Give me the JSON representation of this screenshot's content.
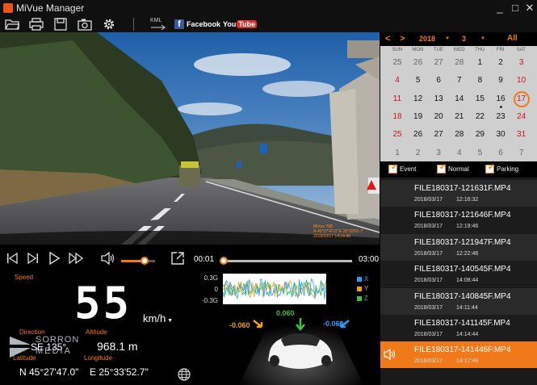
{
  "window": {
    "title": "MiVue Manager",
    "controls": {
      "minimize": "_",
      "maximize": "□",
      "close": "✕"
    }
  },
  "toolbar": {
    "icons": [
      "folder-open-icon",
      "print-icon",
      "save-icon",
      "camera-icon",
      "gear-icon",
      "kml-export-icon"
    ],
    "kml_label": "KML",
    "facebook_label": "Facebook",
    "facebook_mark": "f",
    "youtube_you": "You",
    "youtube_tube": "Tube"
  },
  "video": {
    "overlay_lines": [
      "MiVue 798",
      "N 45°27'47.0\" E 25°33'52.7\"",
      "2018/03/17 14:14:46"
    ]
  },
  "player": {
    "time_current": "00:01",
    "time_total": "03:00",
    "progress": 0.005,
    "volume": 0.7
  },
  "telemetry": {
    "speed_label": "Speed",
    "speed_value": "55",
    "speed_unit": "km/h",
    "direction_label": "Direction",
    "direction_value": "SE 135°",
    "altitude_label": "Altitude",
    "altitude_value": "968.1  m",
    "latitude_label": "Latitude",
    "latitude_value": "N 45°27'47.0\"",
    "longitude_label": "Longitude",
    "longitude_value": "E 25°33'52.7\""
  },
  "watermark": {
    "top": "SORRON",
    "bottom": "MEDIA"
  },
  "gsensor": {
    "axis_labels": [
      "0.3G",
      "0",
      "-0.3G"
    ],
    "legend": [
      {
        "name": "X",
        "color": "#2a9df4"
      },
      {
        "name": "Y",
        "color": "#f0a020"
      },
      {
        "name": "Z",
        "color": "#3cc23c"
      }
    ],
    "x_value": "-0.060",
    "y_value": "-0.060",
    "z_value": "0.060"
  },
  "calendar": {
    "year": "2018",
    "month": "3",
    "all_label": "All",
    "weekdays": [
      "SUN",
      "MON",
      "TUE",
      "WED",
      "THU",
      "FRI",
      "SAT"
    ],
    "weeks": [
      [
        "25",
        "26",
        "27",
        "28",
        "1",
        "2",
        "3"
      ],
      [
        "4",
        "5",
        "6",
        "7",
        "8",
        "9",
        "10"
      ],
      [
        "11",
        "12",
        "13",
        "14",
        "15",
        "16",
        "17"
      ],
      [
        "18",
        "19",
        "20",
        "21",
        "22",
        "23",
        "24"
      ],
      [
        "25",
        "26",
        "27",
        "28",
        "29",
        "30",
        "31"
      ],
      [
        "1",
        "2",
        "3",
        "4",
        "5",
        "6",
        "7"
      ]
    ],
    "colors": {
      "weekend": "#c8161d",
      "weekday": "#111111",
      "other_month": "#666666"
    },
    "selected_day": "17"
  },
  "filters": [
    {
      "label": "Event",
      "checked": true
    },
    {
      "label": "Normal",
      "checked": true
    },
    {
      "label": "Parking",
      "checked": true
    }
  ],
  "files": [
    {
      "name": "FILE180317-121631F.MP4",
      "date": "2018/03/17",
      "time": "12:16:32"
    },
    {
      "name": "FILE180317-121646F.MP4",
      "date": "2018/03/17",
      "time": "12:19:46"
    },
    {
      "name": "FILE180317-121947F.MP4",
      "date": "2018/03/17",
      "time": "12:22:46"
    },
    {
      "name": "FILE180317-140545F.MP4",
      "date": "2018/03/17",
      "time": "14:08:44"
    },
    {
      "name": "FILE180317-140845F.MP4",
      "date": "2018/03/17",
      "time": "14:11:44"
    },
    {
      "name": "FILE180317-141145F.MP4",
      "date": "2018/03/17",
      "time": "14:14:44"
    },
    {
      "name": "FILE180317-141446F.MP4",
      "date": "2018/03/17",
      "time": "14:17:46",
      "selected": true
    }
  ],
  "colors": {
    "accent": "#f07a1a",
    "selected_row": "#f07a1a"
  }
}
